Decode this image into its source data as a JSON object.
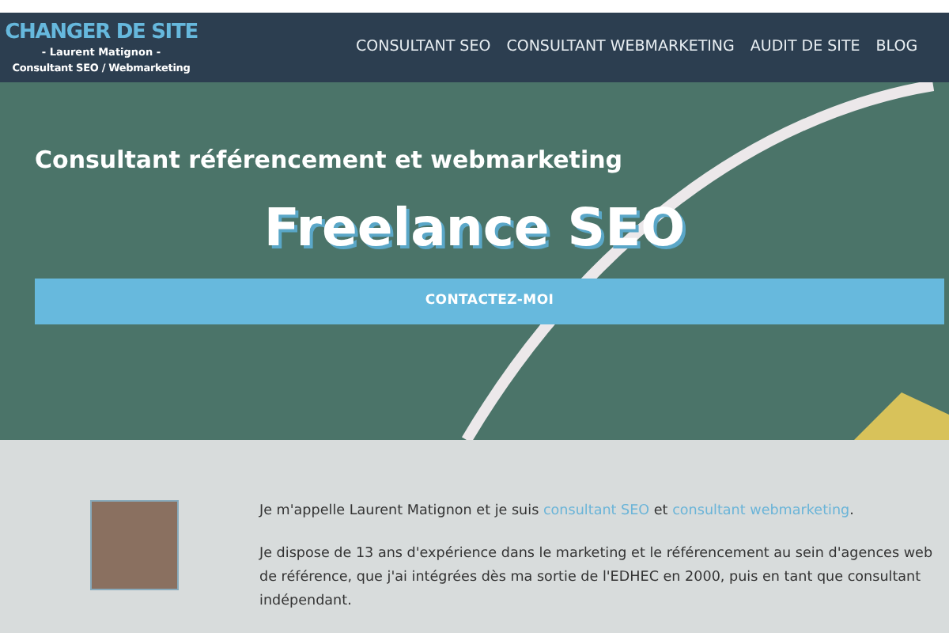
{
  "header": {
    "logo": {
      "title": "CHANGER DE SITE",
      "name_line": "- Laurent Matignon -",
      "tagline": "Consultant SEO / Webmarketing"
    },
    "nav": [
      "CONSULTANT SEO",
      "CONSULTANT WEBMARKETING",
      "AUDIT DE SITE",
      "BLOG"
    ]
  },
  "hero": {
    "subtitle": "Consultant référencement et webmarketing",
    "title": "Freelance SEO",
    "button": "CONTACTEZ-MOI"
  },
  "about": {
    "paragraphs": [
      [
        {
          "kind": "text",
          "text": "Je m'appelle Laurent Matignon et je suis "
        },
        {
          "kind": "link",
          "text": "consultant SEO"
        },
        {
          "kind": "text",
          "text": " et "
        },
        {
          "kind": "link",
          "text": "consultant webmarketing"
        },
        {
          "kind": "text",
          "text": "."
        }
      ],
      [
        {
          "kind": "text",
          "text": "Je dispose de 13 ans d'expérience dans le marketing et le référencement au sein d'agences web de référence, que j'ai intégrées dès ma sortie de l'EDHEC en 2000, puis en tant que consultant indépendant."
        }
      ]
    ]
  }
}
